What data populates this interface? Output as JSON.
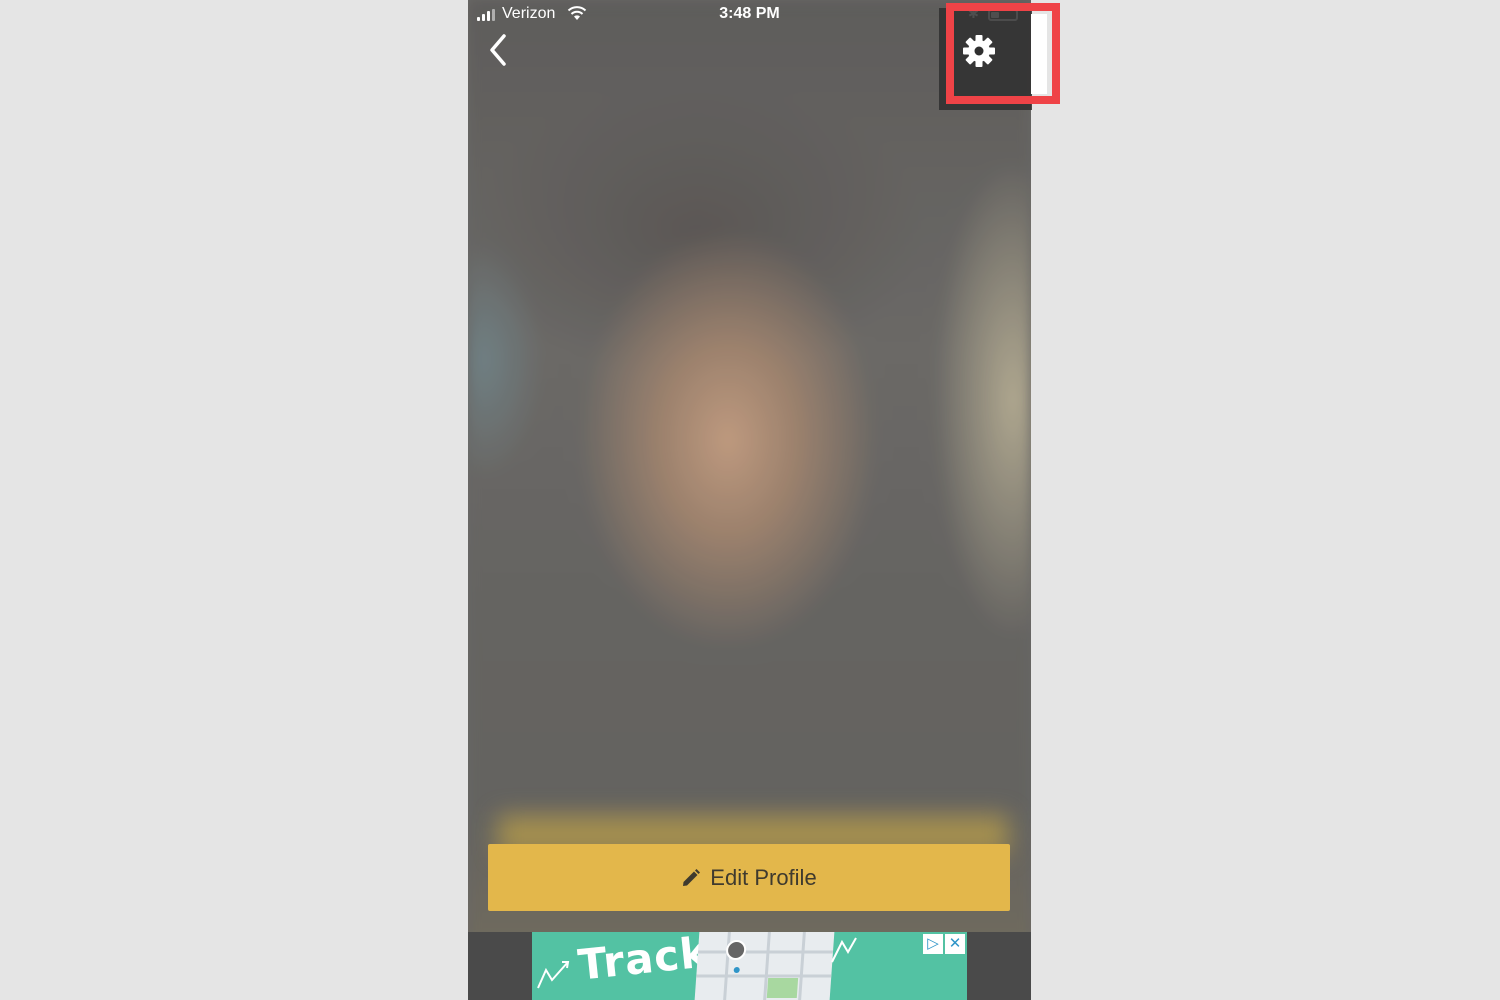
{
  "status_bar": {
    "carrier": "Verizon",
    "time": "3:48 PM",
    "battery_level": 0.35
  },
  "nav": {
    "back_icon": "chevron-left-icon",
    "settings_icon": "gear-icon"
  },
  "profile": {
    "edit_button_label": "Edit Profile",
    "edit_icon": "pencil-icon"
  },
  "ad": {
    "text": "Track",
    "adchoices_icon": "adchoices-icon",
    "close_icon": "close-icon"
  },
  "colors": {
    "edit_button": "#e3b74b",
    "highlight": "#ef4347",
    "ad_background": "#53c2a3"
  }
}
